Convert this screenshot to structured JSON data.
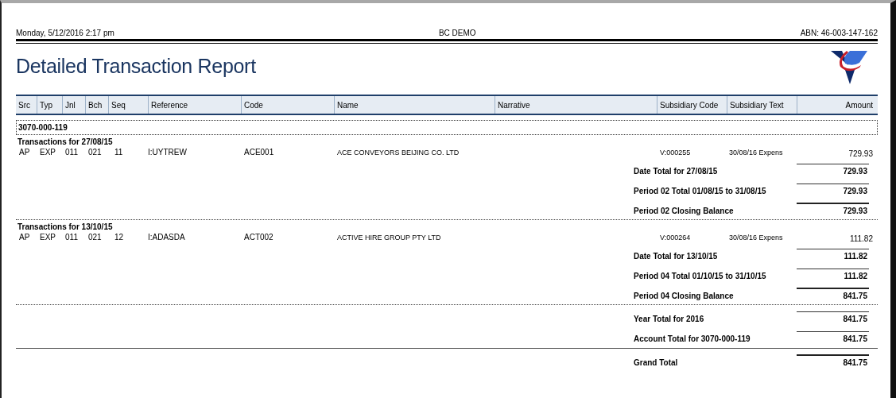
{
  "header": {
    "printed": "Monday, 5/12/2016  2:17 pm",
    "company": "BC DEMO",
    "abn": "ABN: 46-003-147-162"
  },
  "title": "Detailed Transaction Report",
  "columns": [
    "Src",
    "Typ",
    "Jnl",
    "Bch",
    "Seq",
    "Reference",
    "Code",
    "Name",
    "Narrative",
    "Subsidiary Code",
    "Subsidiary Text",
    "Amount"
  ],
  "account": "3070-000-119",
  "sections": [
    {
      "heading": "Transactions for 27/08/15",
      "rows": [
        {
          "src": "AP",
          "typ": "EXP",
          "jnl": "011",
          "bch": "021",
          "seq": "11",
          "reference": "I:UYTREW",
          "code": "ACE001",
          "name": "ACE CONVEYORS BEIJING CO. LTD",
          "subsidiary_code": "V:000255",
          "subsidiary_text": "30/08/16 Expens",
          "amount": "729.93"
        }
      ],
      "totals": [
        {
          "label": "Date Total for 27/08/15",
          "amount": "729.93",
          "thick": false
        },
        {
          "label": "Period 02 Total  01/08/15 to 31/08/15",
          "amount": "729.93",
          "thick": false
        },
        {
          "label": "Period 02 Closing Balance",
          "amount": "729.93",
          "thick": true
        }
      ],
      "dotted_divider": true,
      "solid_divider": false
    },
    {
      "heading": "Transactions for 13/10/15",
      "rows": [
        {
          "src": "AP",
          "typ": "EXP",
          "jnl": "011",
          "bch": "021",
          "seq": "12",
          "reference": "I:ADASDA",
          "code": "ACT002",
          "name": "ACTIVE HIRE GROUP PTY LTD",
          "subsidiary_code": "V:000264",
          "subsidiary_text": "30/08/16 Expens",
          "amount": "111.82"
        }
      ],
      "totals": [
        {
          "label": "Date Total for 13/10/15",
          "amount": "111.82",
          "thick": false
        },
        {
          "label": "Period 04 Total  01/10/15 to 31/10/15",
          "amount": "111.82",
          "thick": false
        },
        {
          "label": "Period 04 Closing Balance",
          "amount": "841.75",
          "thick": true
        }
      ],
      "dotted_divider": true,
      "solid_divider": false
    },
    {
      "totals": [
        {
          "label": "Year Total for 2016",
          "amount": "841.75",
          "thick": false
        },
        {
          "label": "Account Total for 3070-000-119",
          "amount": "841.75",
          "thick": false
        }
      ],
      "dotted_divider": false,
      "solid_divider": true
    },
    {
      "totals": [
        {
          "label": "Grand Total",
          "amount": "841.75",
          "thick": true
        }
      ],
      "dotted_divider": false,
      "solid_divider": false
    }
  ]
}
